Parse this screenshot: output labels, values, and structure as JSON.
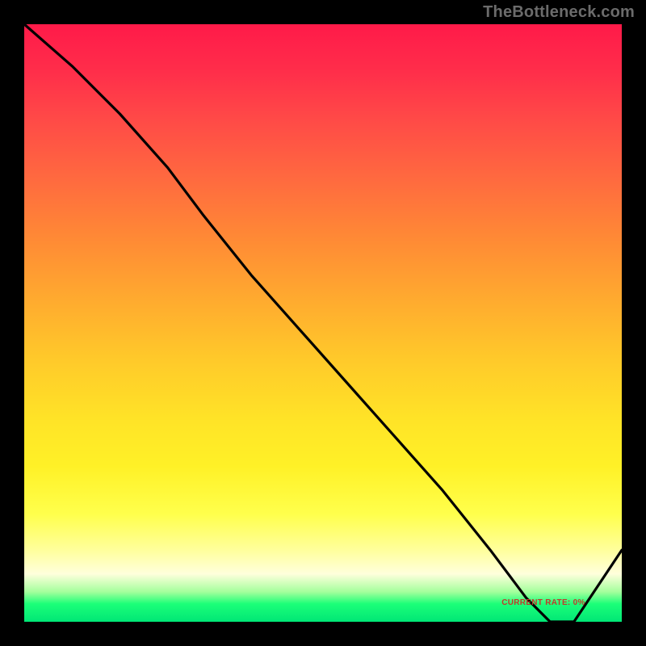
{
  "watermark": "TheBottleneck.com",
  "annotation": {
    "label": "CURRENT RATE: 0%"
  },
  "colors": {
    "black": "#000000",
    "line": "#000000",
    "watermark": "#6b6b6b",
    "annotation": "#c0392b",
    "gradient_top": "#ff1a49",
    "gradient_bottom": "#00e676"
  },
  "chart_data": {
    "type": "line",
    "title": "",
    "xlabel": "",
    "ylabel": "",
    "xlim": [
      0,
      100
    ],
    "ylim": [
      0,
      100
    ],
    "grid": false,
    "legend": false,
    "series": [
      {
        "name": "bottleneck-curve",
        "x": [
          0,
          8,
          16,
          24,
          30,
          38,
          46,
          54,
          62,
          70,
          78,
          84,
          88,
          92,
          100
        ],
        "values": [
          100,
          93,
          85,
          76,
          68,
          58,
          49,
          40,
          31,
          22,
          12,
          4,
          0,
          0,
          12
        ]
      }
    ],
    "annotations": [
      {
        "text": "CURRENT RATE: 0%",
        "x": 88,
        "y": 2
      }
    ]
  }
}
